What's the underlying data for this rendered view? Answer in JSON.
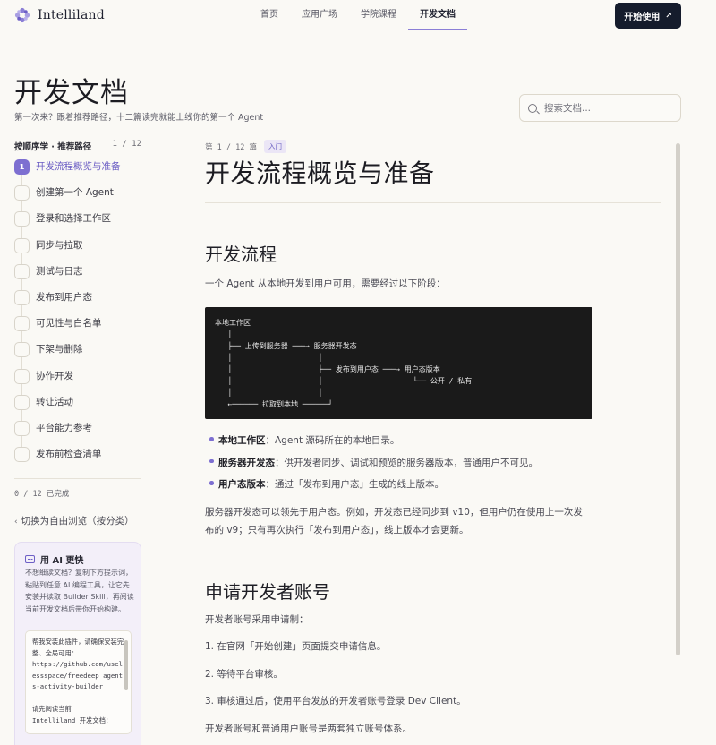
{
  "header": {
    "logo_text": "Intelliland",
    "nav": [
      "首页",
      "应用广场",
      "学院课程",
      "开发文档"
    ],
    "active_nav": "开发文档",
    "cta_label": "开始使用",
    "cta_icon": "arrow-up-right-icon",
    "accent": "#7d6fd1",
    "cta_bg": "#151c2c"
  },
  "hero": {
    "title": "开发文档",
    "subtitle": "第一次来？跟着推荐路径，十二篇读完就能上线你的第一个 Agent",
    "search_placeholder": "搜索文档..."
  },
  "sidebar": {
    "heading": "按顺序学 · 推荐路径",
    "counter": "1 / 12",
    "steps": [
      {
        "num": "1",
        "label": "开发流程概览与准备"
      },
      {
        "num": "",
        "label": "创建第一个 Agent"
      },
      {
        "num": "",
        "label": "登录和选择工作区"
      },
      {
        "num": "",
        "label": "同步与拉取"
      },
      {
        "num": "",
        "label": "测试与日志"
      },
      {
        "num": "",
        "label": "发布到用户态"
      },
      {
        "num": "",
        "label": "可见性与白名单"
      },
      {
        "num": "",
        "label": "下架与删除"
      },
      {
        "num": "",
        "label": "协作开发"
      },
      {
        "num": "",
        "label": "转让活动"
      },
      {
        "num": "",
        "label": "平台能力参考"
      },
      {
        "num": "",
        "label": "发布前检查清单"
      }
    ],
    "progress": "0 / 12 已完成",
    "free_browse": "切换为自由浏览（按分类）",
    "ai_card": {
      "title": "用 AI 更快",
      "desc": "不想细读文档？复制下方提示词，粘贴到任意 AI 编程工具，让它先安装并读取 Builder Skill，再阅读当前开发文档后带你开始构建。",
      "prompt": "帮我安装此插件，请确保安装完整、全局可用：\nhttps://github.com/uselessspace/freedeep agents-activity-builder\n\n请先阅读当前\nIntelliland 开发文档："
    }
  },
  "article": {
    "meta": "第 1 / 12 篇",
    "tag": "入门",
    "title": "开发流程概览与准备",
    "h2_flow": "开发流程",
    "p_flow": "一个 Agent 从本地开发到用户可用，需要经过以下阶段：",
    "code": "本地工作区\n   │\n   ├── 上传到服务器 ───→ 服务器开发态\n   │                    │\n   │                    ├── 发布到用户态 ───→ 用户态版本\n   │                    │                     └── 公开 / 私有\n   │                    │\n   ←────── 拉取到本地 ──────┘",
    "bullets": [
      {
        "term": "本地工作区",
        "text": "：Agent 源码所在的本地目录。"
      },
      {
        "term": "服务器开发态",
        "text": "：供开发者同步、调试和预览的服务器版本，普通用户不可见。"
      },
      {
        "term": "用户态版本",
        "text": "：通过「发布到用户态」生成的线上版本。"
      }
    ],
    "p_note": "服务器开发态可以领先于用户态。例如，开发态已经同步到 v10，但用户仍在使用上一次发布的 v9；只有再次执行「发布到用户态」，线上版本才会更新。",
    "h2_account": "申请开发者账号",
    "p_account": "开发者账号采用申请制：",
    "steps": [
      "1. 在官网「开始创建」页面提交申请信息。",
      "2. 等待平台审核。",
      "3. 审核通过后，使用平台发放的开发者账号登录 Dev Client。"
    ],
    "p_last": "开发者账号和普通用户账号是两套独立账号体系。"
  }
}
